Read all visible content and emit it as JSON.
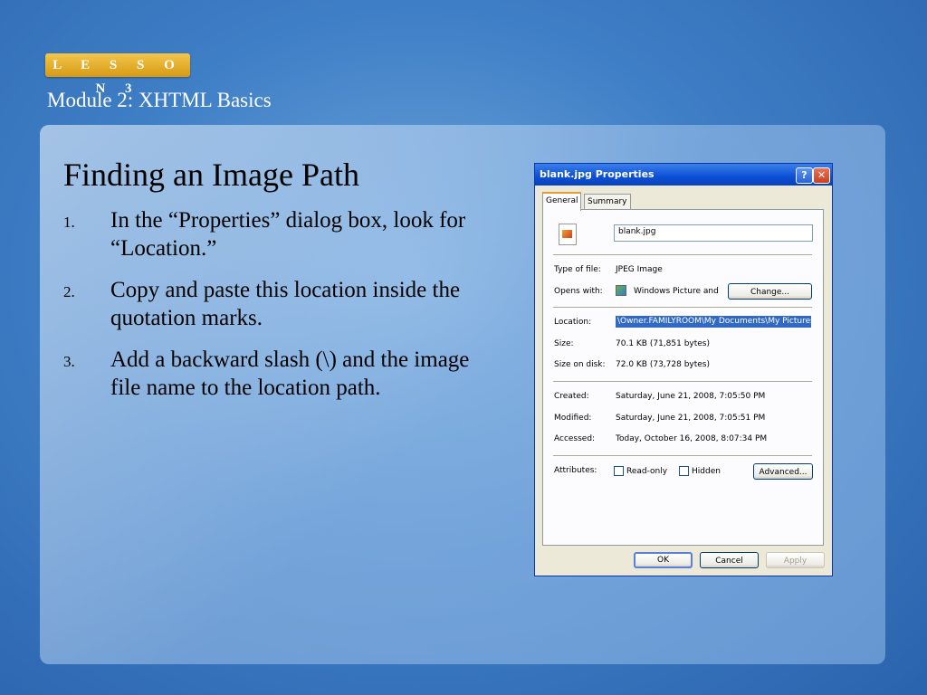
{
  "header": {
    "lesson_badge": "L E S S O N   3",
    "module_title": "Module 2: XHTML Basics"
  },
  "slide": {
    "title": "Finding an Image Path",
    "steps": [
      {
        "num": "1.",
        "text": "In the “Properties” dialog box, look for “Location.”"
      },
      {
        "num": "2.",
        "text": "Copy and paste this location inside the quotation marks."
      },
      {
        "num": "3.",
        "text": "Add a backward slash (\\) and the image file name to the location path."
      }
    ]
  },
  "dialog": {
    "title": "blank.jpg Properties",
    "help_glyph": "?",
    "close_glyph": "✕",
    "tabs": [
      "General",
      "Summary"
    ],
    "file_name": "blank.jpg",
    "type_label": "Type of file:",
    "type_value": "JPEG Image",
    "opens_label": "Opens with:",
    "opens_value": "Windows Picture and F",
    "change_button": "Change...",
    "location_label": "Location:",
    "location_value": "\\Owner.FAMILYROOM\\My Documents\\My Pictures",
    "size_label": "Size:",
    "size_value": "70.1 KB (71,851 bytes)",
    "size_on_disk_label": "Size on disk:",
    "size_on_disk_value": "72.0 KB (73,728 bytes)",
    "created_label": "Created:",
    "created_value": "Saturday, June 21, 2008, 7:05:50 PM",
    "modified_label": "Modified:",
    "modified_value": "Saturday, June 21, 2008, 7:05:51 PM",
    "accessed_label": "Accessed:",
    "accessed_value": "Today, October 16, 2008, 8:07:34 PM",
    "attributes_label": "Attributes:",
    "readonly_label": "Read-only",
    "hidden_label": "Hidden",
    "advanced_button": "Advanced...",
    "ok_button": "OK",
    "cancel_button": "Cancel",
    "apply_button": "Apply"
  }
}
